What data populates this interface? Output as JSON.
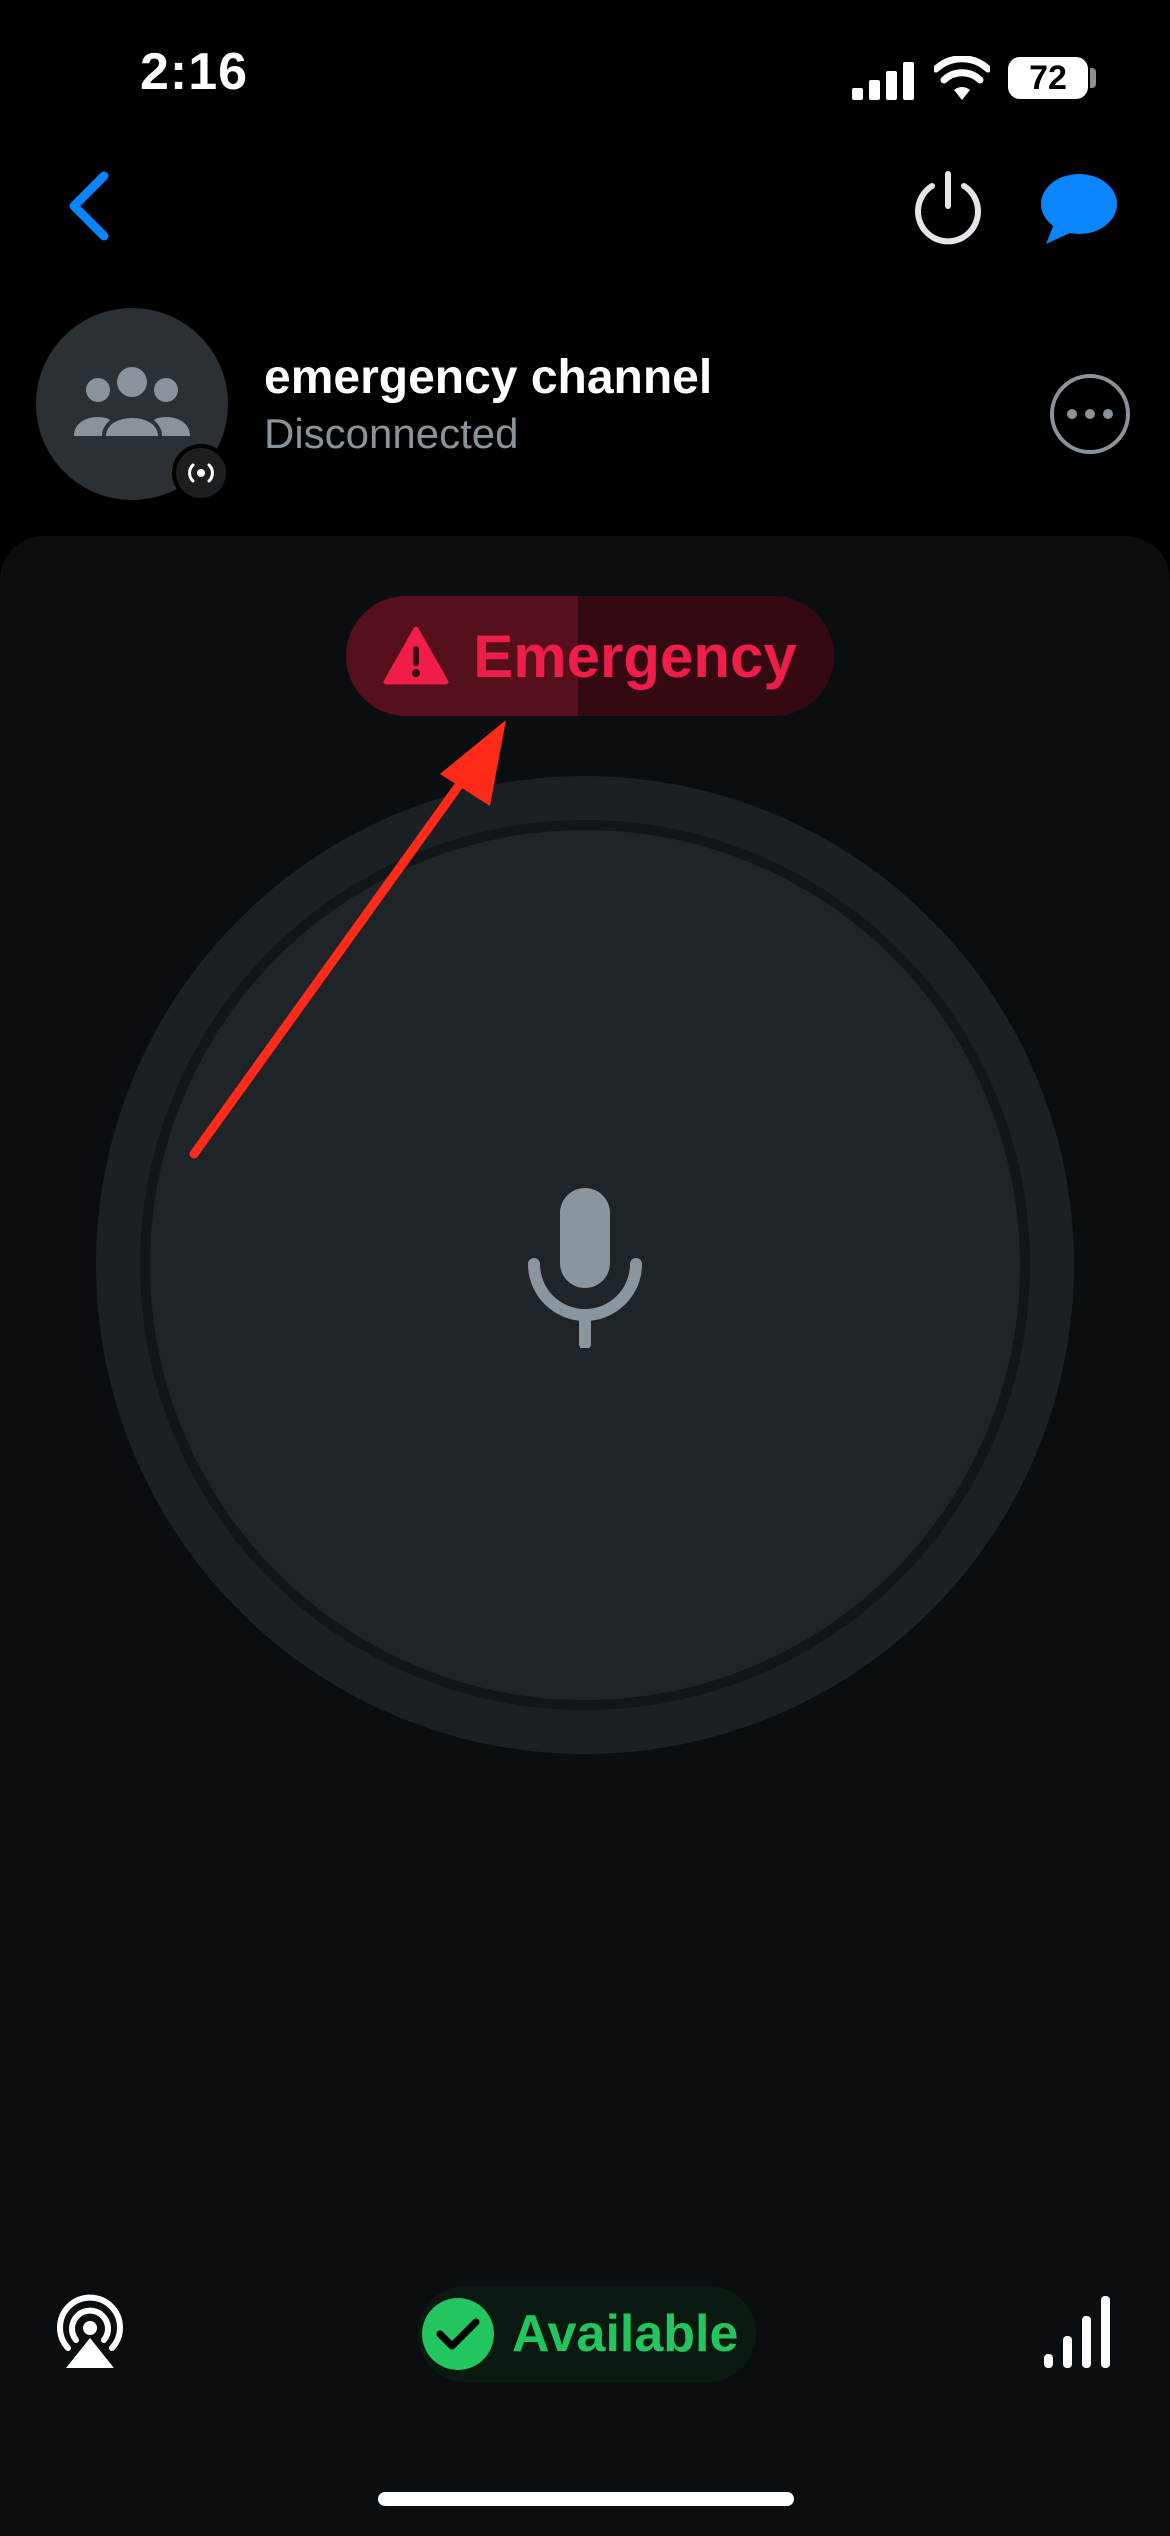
{
  "status_bar": {
    "time": "2:16",
    "battery": "72"
  },
  "nav": {
    "back_icon": "chevron-left-icon",
    "power_icon": "power-icon",
    "chat_icon": "chat-bubble-icon"
  },
  "channel": {
    "name": "emergency channel",
    "status": "Disconnected",
    "avatar_icon": "group-icon",
    "badge_icon": "broadcast-icon"
  },
  "emergency_button": {
    "label": "Emergency",
    "icon": "warning-triangle-icon"
  },
  "footer": {
    "availability_label": "Available",
    "left_icon": "airplay-icon",
    "right_icon": "signal-bars-icon"
  },
  "colors": {
    "accent_blue": "#0a84ff",
    "emergency_red": "#ee1d4a",
    "available_green": "#22c55e",
    "annotation_arrow": "#ff2a1a"
  }
}
